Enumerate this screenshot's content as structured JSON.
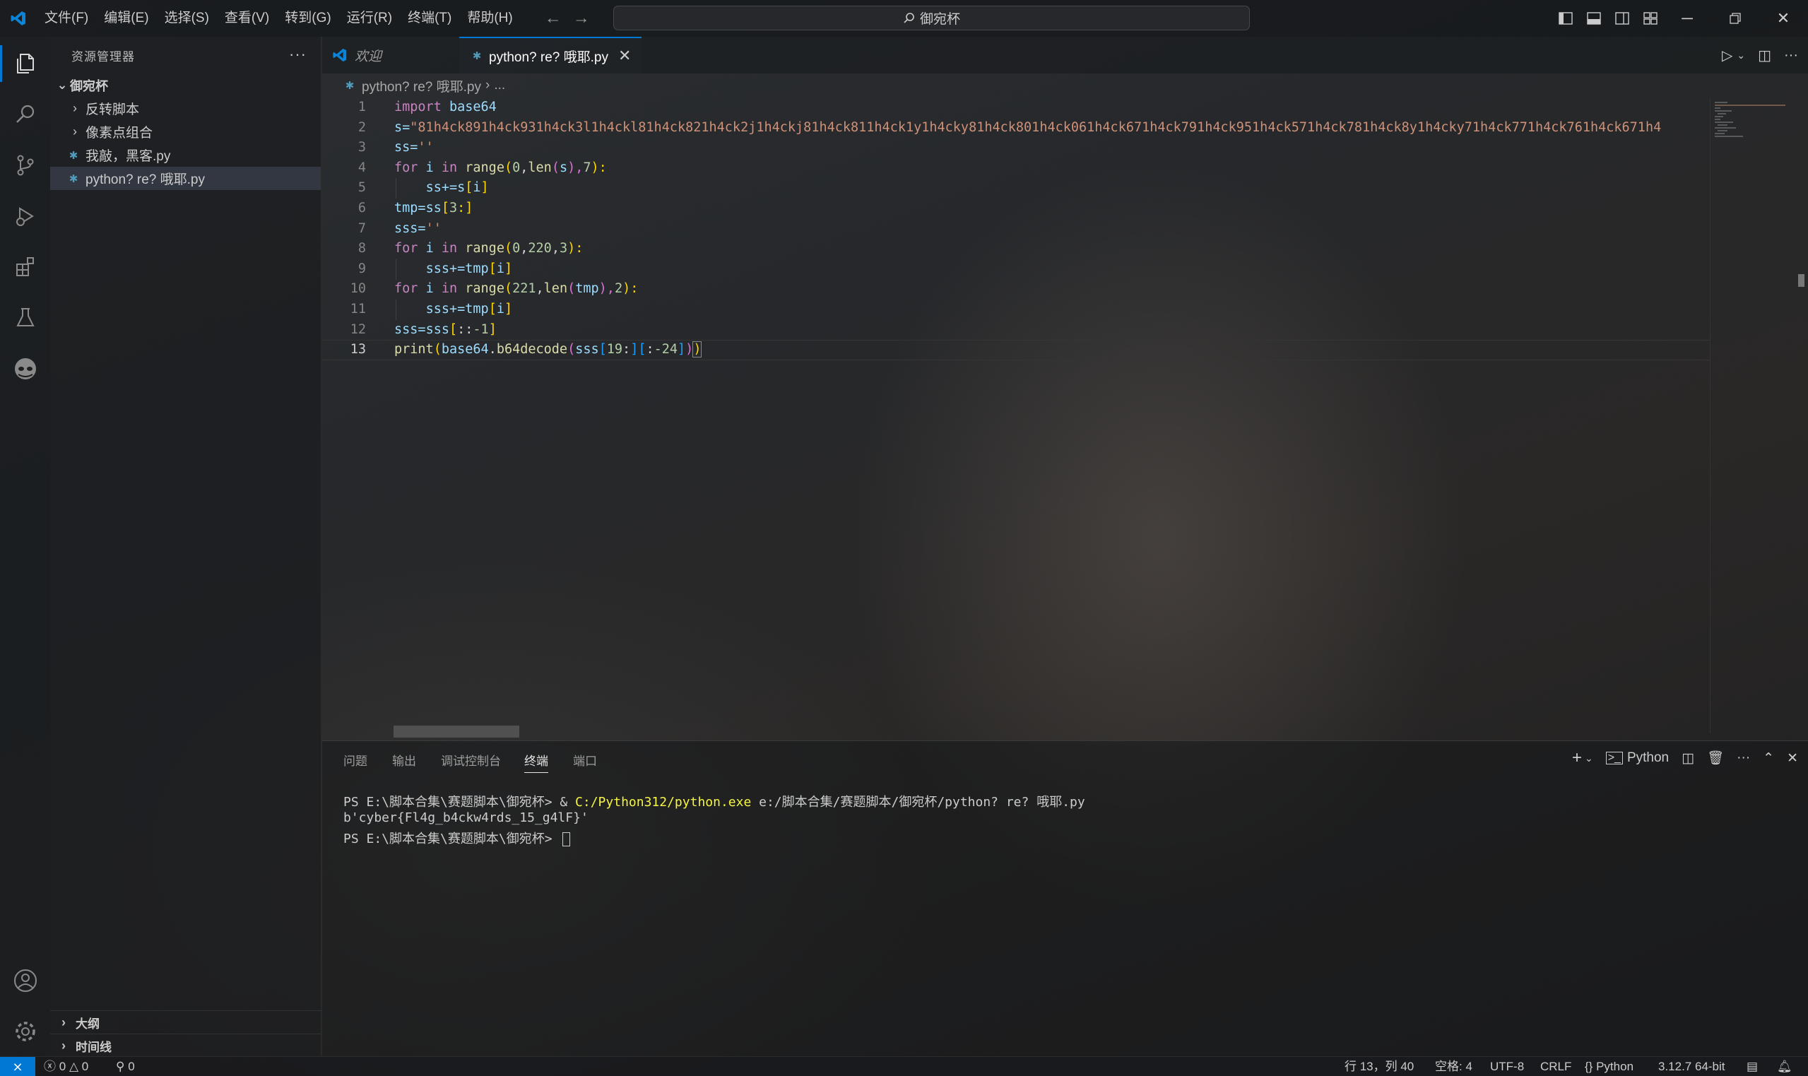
{
  "titlebar": {
    "menu": [
      "文件(F)",
      "编辑(E)",
      "选择(S)",
      "查看(V)",
      "转到(G)",
      "运行(R)",
      "终端(T)",
      "帮助(H)"
    ],
    "search": "御宛杯",
    "window_controls": [
      "minimize-icon",
      "restore-icon",
      "close-icon"
    ]
  },
  "activitybar": {
    "items": [
      "explorer-icon",
      "search-icon",
      "source-control-icon",
      "run-debug-icon",
      "extensions-icon",
      "testing-icon",
      "copilot-icon"
    ],
    "bottom": [
      "account-icon",
      "settings-gear-icon"
    ]
  },
  "sidebar": {
    "title": "资源管理器",
    "root": "御宛杯",
    "items": [
      {
        "label": "反转脚本",
        "type": "folder"
      },
      {
        "label": "像素点组合",
        "type": "folder"
      },
      {
        "label": "我敲，黑客.py",
        "type": "python"
      },
      {
        "label": "python? re? 哦耶.py",
        "type": "python",
        "selected": true
      }
    ],
    "sections": [
      "大纲",
      "时间线"
    ]
  },
  "tabs": [
    {
      "label": "欢迎",
      "active": false
    },
    {
      "label": "python? re? 哦耶.py",
      "active": true
    }
  ],
  "breadcrumb": {
    "file": "python? re? 哦耶.py",
    "more": "..."
  },
  "code": {
    "line_numbers": [
      "1",
      "2",
      "3",
      "4",
      "5",
      "6",
      "7",
      "8",
      "9",
      "10",
      "11",
      "12",
      "13"
    ],
    "line1": [
      "import",
      "base64"
    ],
    "line2": [
      "s=",
      "\"81h4ck891h4ck931h4ck3l1h4ckl81h4ck821h4ck2j1h4ckj81h4ck811h4ck1y1h4cky81h4ck801h4ck061h4ck671h4ck791h4ck951h4ck571h4ck781h4ck8y1h4cky71h4ck771h4ck761h4ck671h4"
    ],
    "line3": [
      "ss=",
      "''"
    ],
    "line4": [
      "for",
      "i",
      "in",
      "range",
      "(",
      "0",
      ",",
      "len",
      "(",
      "s",
      "),",
      "7",
      "):"
    ],
    "line5": [
      "ss+=",
      "s",
      "[",
      "i",
      "]"
    ],
    "line6": [
      "tmp=",
      "ss",
      "[",
      "3",
      ":]"
    ],
    "line7": [
      "sss=",
      "''"
    ],
    "line8": [
      "for",
      "i",
      "in",
      "range",
      "(",
      "0",
      ",",
      "220",
      ",",
      "3",
      "):"
    ],
    "line9": [
      "sss+=",
      "tmp",
      "[",
      "i",
      "]"
    ],
    "line10": [
      "for",
      "i",
      "in",
      "range",
      "(",
      "221",
      ",",
      "len",
      "(",
      "tmp",
      "),",
      "2",
      "):"
    ],
    "line11": [
      "sss+=",
      "tmp",
      "[",
      "i",
      "]"
    ],
    "line12": [
      "sss=",
      "sss",
      "[",
      "::",
      "-1",
      "]"
    ],
    "line13": [
      "print",
      "(",
      "base64",
      ".",
      "b64decode",
      "(",
      "sss",
      "[",
      "19",
      ":",
      "]",
      "[",
      ":",
      "-24",
      "]",
      ")",
      ")"
    ]
  },
  "panel": {
    "tabs": [
      "问题",
      "输出",
      "调试控制台",
      "终端",
      "端口"
    ],
    "active_tab": "终端",
    "shell": "Python",
    "terminal": {
      "line1_prompt": "PS E:\\脚本合集\\赛题脚本\\御宛杯> & ",
      "line1_exe": "C:/Python312/python.exe",
      "line1_arg": " e:/脚本合集/赛题脚本/御宛杯/python? re? 哦耶.py",
      "line2": "b'cyber{Fl4g_b4ckw4rds_15_g4lF}'",
      "line3_prompt": "PS E:\\脚本合集\\赛题脚本\\御宛杯> "
    }
  },
  "statusbar": {
    "errors": "0",
    "warnings": "0",
    "ports": "0",
    "position": "行 13，列 40",
    "spaces": "空格: 4",
    "encoding": "UTF-8",
    "eol": "CRLF",
    "language": "Python",
    "interpreter": "3.12.7 64-bit"
  },
  "colors": {
    "accent": "#0078d4",
    "keyword": "#c586c0",
    "string": "#ce9178",
    "function": "#dcdcaa",
    "variable": "#9cdcfe",
    "number": "#b5cea8"
  }
}
